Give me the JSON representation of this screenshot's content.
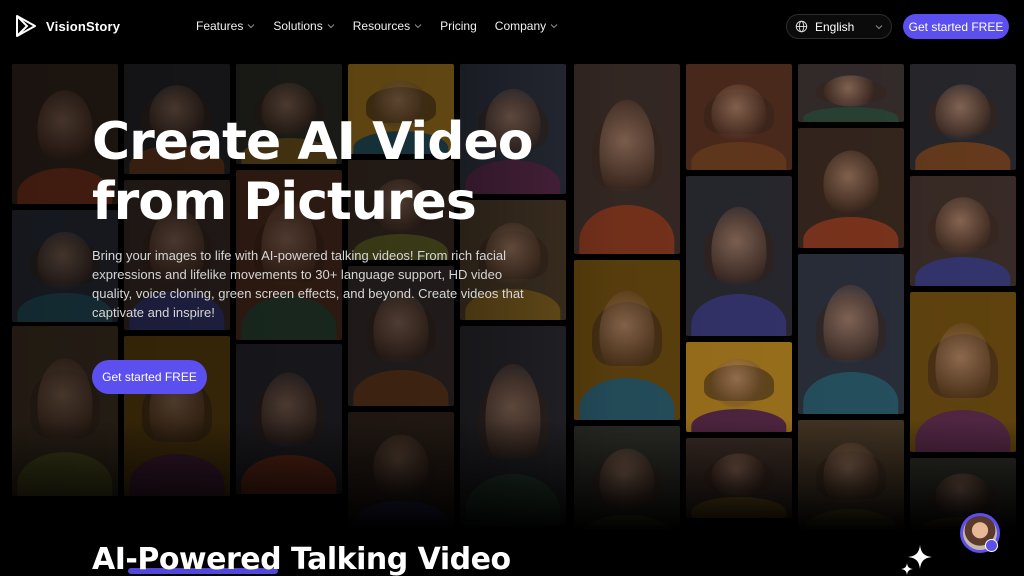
{
  "brand": {
    "name": "VisionStory"
  },
  "nav": {
    "items": [
      {
        "label": "Features",
        "has_dropdown": true
      },
      {
        "label": "Solutions",
        "has_dropdown": true
      },
      {
        "label": "Resources",
        "has_dropdown": true
      },
      {
        "label": "Pricing",
        "has_dropdown": false
      },
      {
        "label": "Company",
        "has_dropdown": true
      }
    ],
    "language": "English",
    "cta": "Get started FREE"
  },
  "hero": {
    "title_line1": "Create AI Video",
    "title_line2": "from Pictures",
    "subtitle": "Bring your images to life with AI-powered talking videos! From rich facial expressions and lifelike movements to 30+ language support, HD video quality, voice cloning, green screen effects, and beyond. Create videos that captivate and inspire!",
    "cta": "Get started FREE"
  },
  "next_section": {
    "title": "AI-Powered Talking Video"
  },
  "colors": {
    "accent": "#5b4ff0",
    "background": "#000000"
  },
  "icons": [
    "play-logo-icon",
    "globe-icon",
    "chevron-down-icon",
    "sparkle-icon",
    "support-avatar-icon"
  ]
}
